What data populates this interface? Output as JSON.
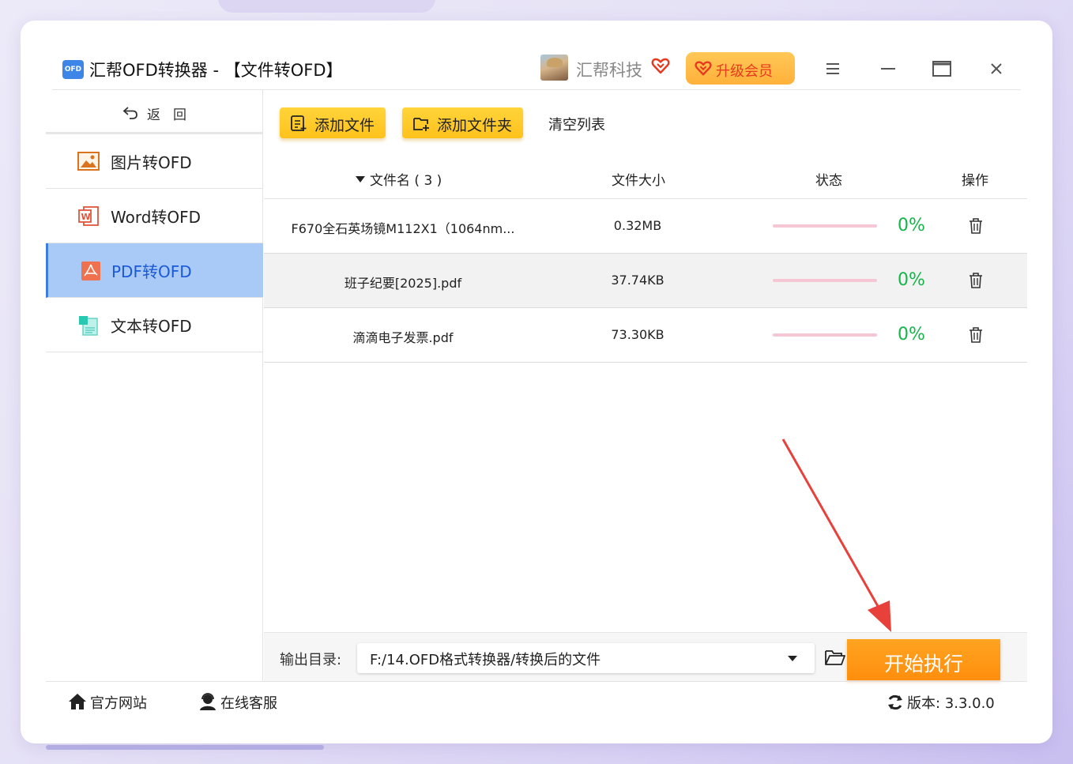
{
  "app": {
    "logo_text": "OFD",
    "title": "汇帮OFD转换器 - 【文件转OFD】",
    "company": "汇帮科技",
    "upgrade_label": "升级会员"
  },
  "sidebar": {
    "back_label": "返回",
    "items": [
      {
        "label": "图片转OFD",
        "icon": "image-icon",
        "active": false
      },
      {
        "label": "Word转OFD",
        "icon": "word-icon",
        "active": false
      },
      {
        "label": "PDF转OFD",
        "icon": "pdf-icon",
        "active": true
      },
      {
        "label": "文本转OFD",
        "icon": "text-file-icon",
        "active": false
      }
    ]
  },
  "toolbar": {
    "add_file": "添加文件",
    "add_folder": "添加文件夹",
    "clear_list": "清空列表"
  },
  "table": {
    "headers": {
      "name": "文件名 ( 3 )",
      "size": "文件大小",
      "status": "状态",
      "op": "操作"
    },
    "rows": [
      {
        "name": "F670全石英场镜M112X1（1064nm...",
        "size": "0.32MB",
        "progress": "0%"
      },
      {
        "name": "班子纪要[2025].pdf",
        "size": "37.74KB",
        "progress": "0%"
      },
      {
        "name": "滴滴电子发票.pdf",
        "size": "73.30KB",
        "progress": "0%"
      }
    ]
  },
  "output": {
    "label": "输出目录:",
    "path": "F:/14.OFD格式转换器/转换后的文件",
    "start_label": "开始执行"
  },
  "footer": {
    "official_site": "官方网站",
    "online_service": "在线客服",
    "version": "版本:  3.3.0.0"
  },
  "colors": {
    "accent_blue": "#3a7ee4",
    "toolbar_yellow": "#ffc21c",
    "start_orange": "#ff8e0d",
    "progress_green": "#15b54a",
    "annotation_red": "#e8403a"
  }
}
